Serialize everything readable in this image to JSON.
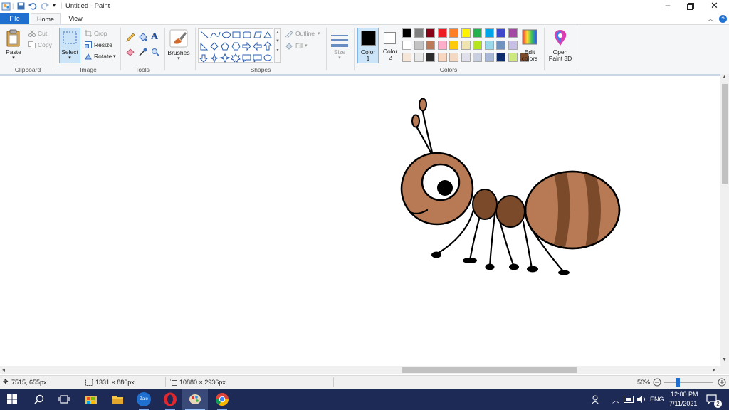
{
  "window": {
    "title": "Untitled - Paint"
  },
  "tabs": {
    "file": "File",
    "home": "Home",
    "view": "View"
  },
  "clipboard": {
    "paste": "Paste",
    "cut": "Cut",
    "copy": "Copy",
    "group": "Clipboard"
  },
  "image": {
    "select": "Select",
    "crop": "Crop",
    "resize": "Resize",
    "rotate": "Rotate",
    "group": "Image"
  },
  "tools": {
    "group": "Tools"
  },
  "brushes": {
    "label": "Brushes"
  },
  "shapes": {
    "group": "Shapes",
    "outline": "Outline",
    "fill": "Fill"
  },
  "size": {
    "label": "Size"
  },
  "colors": {
    "color1": "Color\n1",
    "color1_line1": "Color",
    "color1_line2": "1",
    "color2_line1": "Color",
    "color2_line2": "2",
    "edit_line1": "Edit",
    "edit_line2": "colors",
    "paint3d_line1": "Open",
    "paint3d_line2": "Paint 3D",
    "group": "Colors",
    "palette_row1": [
      "#000000",
      "#7f7f7f",
      "#880015",
      "#ed1c24",
      "#ff7f27",
      "#fff200",
      "#22b14c",
      "#00a2e8",
      "#3f48cc",
      "#a349a4"
    ],
    "palette_row2": [
      "#ffffff",
      "#c3c3c3",
      "#b97a57",
      "#ffaec9",
      "#ffc90e",
      "#efe4b0",
      "#b5e61d",
      "#99d9ea",
      "#7092be",
      "#c8bfe7"
    ],
    "palette_row3": [
      "#f5e6d8",
      "#e8e8e8",
      "#2b2b2b",
      "#f7d7c0",
      "#f3d9c3",
      "#e0e0ec",
      "#c7cfe0",
      "#aab8d8",
      "#0e2a6e",
      "#cde87c",
      "#7a4a2a"
    ],
    "color1_value": "#000000",
    "color2_value": "#ffffff"
  },
  "status": {
    "cursor_pos": "7515, 655px",
    "selection_size": "1331 × 886px",
    "image_size": "10880 × 2936px",
    "zoom": "50%"
  },
  "taskbar": {
    "lang": "ENG",
    "time": "12:00 PM",
    "date": "7/11/2021",
    "zalo_label": "Zalo"
  },
  "drawing": {
    "body_color": "#b87a55",
    "dark_color": "#7a4a2a",
    "outline_color": "#000000"
  }
}
